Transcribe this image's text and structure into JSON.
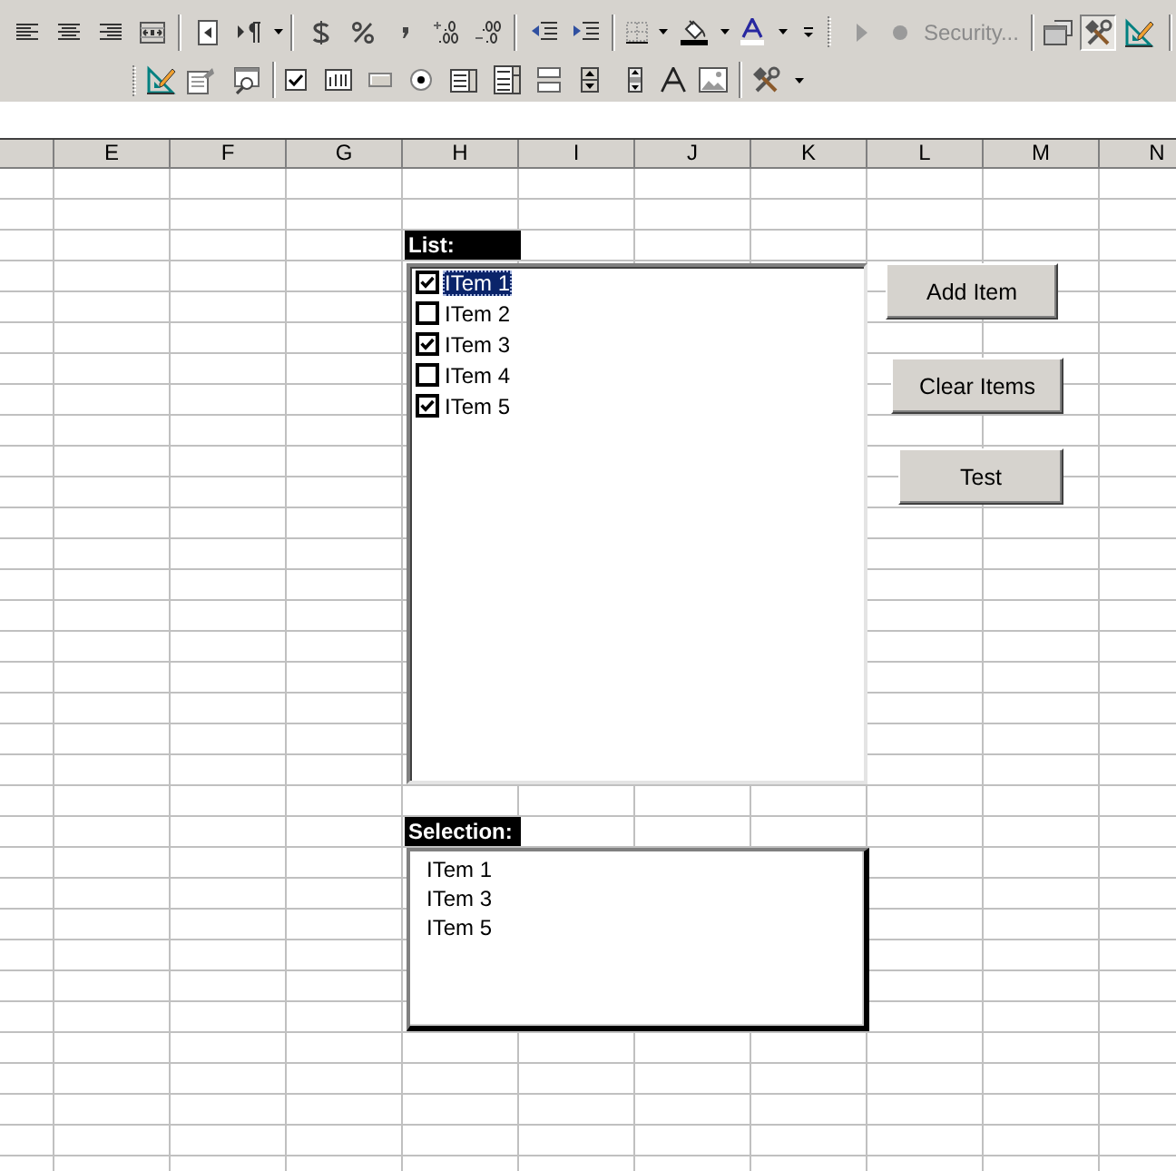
{
  "toolbar": {
    "run_macro": {
      "disabled": true
    },
    "record_macro": {
      "disabled": true
    },
    "security": {
      "label": "Security...",
      "disabled": true
    },
    "control_toolbox": {
      "pressed": true
    }
  },
  "column_headers": [
    "E",
    "F",
    "G",
    "H",
    "I",
    "J",
    "K",
    "L",
    "M",
    "N"
  ],
  "sheet": {
    "list_label": "List:",
    "list_box": {
      "items": [
        {
          "label": "ITem 1",
          "checked": true,
          "selected": true
        },
        {
          "label": "ITem 2",
          "checked": false,
          "selected": false
        },
        {
          "label": "ITem 3",
          "checked": true,
          "selected": false
        },
        {
          "label": "ITem 4",
          "checked": false,
          "selected": false
        },
        {
          "label": "ITem 5",
          "checked": true,
          "selected": false
        }
      ]
    },
    "buttons": [
      "Add Item",
      "Clear Items",
      "Test"
    ],
    "selection_label": "Selection:",
    "selection_box": {
      "items": [
        "ITem 1",
        "ITem 3",
        "ITem 5"
      ]
    }
  }
}
